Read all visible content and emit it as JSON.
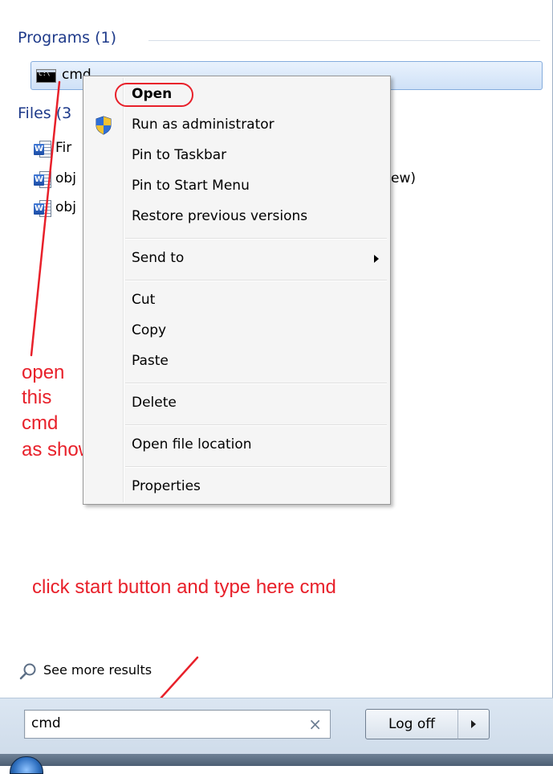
{
  "programs": {
    "header": "Programs (1)",
    "items": [
      {
        "label": "cmd",
        "icon": "cmd-icon"
      }
    ]
  },
  "files": {
    "header": "Files (3",
    "items": [
      {
        "label": "Fir",
        "icon": "word-document-icon"
      },
      {
        "label": "obj",
        "icon": "word-document-icon",
        "trailing": "ew)"
      },
      {
        "label": "obj",
        "icon": "word-document-icon"
      }
    ]
  },
  "context_menu": {
    "items": [
      {
        "label": "Open",
        "bold": true
      },
      {
        "label": "Run as administrator",
        "icon": "uac-shield-icon"
      },
      {
        "label": "Pin to Taskbar"
      },
      {
        "label": "Pin to Start Menu"
      },
      {
        "label": "Restore previous versions"
      },
      {
        "label": "Send to",
        "submenu": true
      },
      {
        "label": "Cut"
      },
      {
        "label": "Copy"
      },
      {
        "label": "Paste"
      },
      {
        "label": "Delete"
      },
      {
        "label": "Open file location"
      },
      {
        "label": "Properties"
      }
    ]
  },
  "annotations": {
    "open_cmd": [
      "open",
      "this",
      "cmd",
      "as shown"
    ],
    "type_hint": "click start button and type here cmd",
    "color": "#e8202a"
  },
  "see_more": {
    "label": "See more results",
    "icon": "search-icon"
  },
  "search": {
    "value": "cmd",
    "clear_icon": "close-icon"
  },
  "logoff": {
    "label": "Log off",
    "arrow_icon": "chevron-right-icon"
  }
}
